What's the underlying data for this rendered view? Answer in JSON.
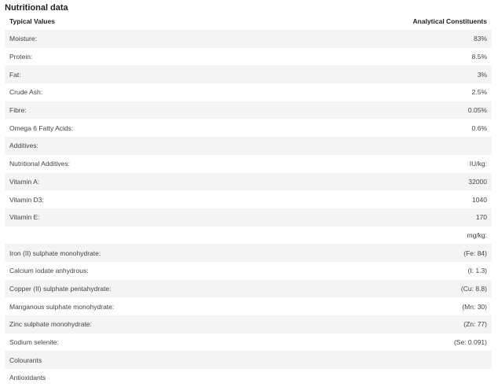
{
  "title": "Nutritional data",
  "header": {
    "left": "Typical Values",
    "right": "Analytical Constituents"
  },
  "rows": [
    {
      "label": "Moisture:",
      "value": "83%"
    },
    {
      "label": "Protein:",
      "value": "8.5%"
    },
    {
      "label": "Fat:",
      "value": "3%"
    },
    {
      "label": "Crude Ash:",
      "value": "2.5%"
    },
    {
      "label": "Fibre:",
      "value": "0.05%"
    },
    {
      "label": "Omega 6 Fatty Acids:",
      "value": "0.6%"
    },
    {
      "label": "Additives:",
      "value": ""
    },
    {
      "label": "Nutritional Additives:",
      "value": "IU/kg:"
    },
    {
      "label": "Vitamin A:",
      "value": "32000"
    },
    {
      "label": "Vitamin D3:",
      "value": "1040"
    },
    {
      "label": "Vitamin E:",
      "value": "170"
    },
    {
      "label": "",
      "value": "mg/kg:"
    },
    {
      "label": "Iron (II) sulphate monohydrate:",
      "value": "(Fe: 84)"
    },
    {
      "label": "Calcium iodate anhydrous:",
      "value": "(I: 1.3)"
    },
    {
      "label": "Copper (II) sulphate pentahydrate:",
      "value": "(Cu: 8.8)"
    },
    {
      "label": "Manganous sulphate monohydrate:",
      "value": "(Mn: 30)"
    },
    {
      "label": "Zinc sulphate monohydrate:",
      "value": "(Zn: 77)"
    },
    {
      "label": "Sodium selenite:",
      "value": "(Se: 0.091)"
    },
    {
      "label": "Colourants",
      "value": ""
    },
    {
      "label": "Antioxidants",
      "value": ""
    }
  ]
}
